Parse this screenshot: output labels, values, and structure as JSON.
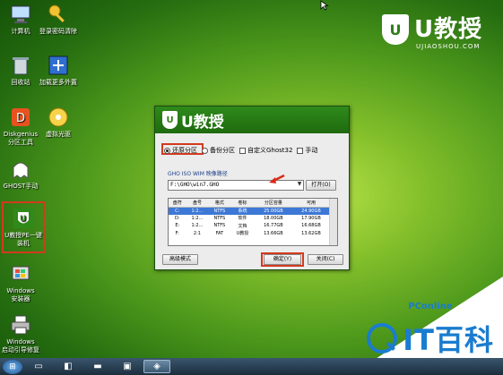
{
  "desktop_icons": [
    {
      "label": "计算机",
      "icon": "computer-icon",
      "name": "desktop-icon-computer"
    },
    {
      "label": "登录密码清除",
      "icon": "key-icon",
      "name": "desktop-icon-password-clear"
    },
    {
      "label": "回收站",
      "icon": "recycle-bin-icon",
      "name": "desktop-icon-recycle-bin"
    },
    {
      "label": "加载更多外置",
      "icon": "puzzle-icon",
      "name": "desktop-icon-load-more"
    },
    {
      "label": "Diskgenius\n分区工具",
      "icon": "diskgenius-icon",
      "name": "desktop-icon-diskgenius"
    },
    {
      "label": "虚拟光驱",
      "icon": "cd-drive-icon",
      "name": "desktop-icon-virtual-drive"
    },
    {
      "label": "GHOST手动",
      "icon": "ghost-icon",
      "name": "desktop-icon-ghost"
    },
    {
      "label": "U教授PE一键\n装机",
      "icon": "ujiaoshou-icon",
      "name": "desktop-icon-pe-install"
    },
    {
      "label": "Windows\n安装器",
      "icon": "windows-installer-icon",
      "name": "desktop-icon-windows-installer"
    },
    {
      "label": "Windows\n启动引导修复",
      "icon": "printer-icon",
      "name": "desktop-icon-boot-repair"
    }
  ],
  "brand": {
    "title": "U教授",
    "subtitle": "UJIAOSHOU.COM",
    "mark": "U"
  },
  "watermark": {
    "line1": "PConline",
    "line2": "IT百科"
  },
  "dialog": {
    "title": "U教授",
    "mark": "U",
    "options": {
      "restore": "还原分区",
      "backup": "备份分区",
      "custom_ghost": "自定义Ghost32",
      "manual": "手动"
    },
    "path_label": "GHO ISO WIM 映像路径",
    "path_value": "F:\\GHO\\win7.GHO",
    "open_button": "打开(O)",
    "table": {
      "headers": [
        "盘符",
        "盘号",
        "格式",
        "卷标",
        "分区容量",
        "可用"
      ],
      "rows": [
        [
          "C:",
          "1:2...",
          "NTFS",
          "系统",
          "25.00GB",
          "24.90GB"
        ],
        [
          "D:",
          "1:2...",
          "NTFS",
          "软件",
          "18.00GB",
          "17.90GB"
        ],
        [
          "E:",
          "1:2...",
          "NTFS",
          "文档",
          "16.77GB",
          "16.68GB"
        ],
        [
          "F:",
          "2:1",
          "FAT",
          "U教授",
          "13.66GB",
          "13.62GB"
        ]
      ]
    },
    "advanced_button": "高级模式",
    "ok_button": "确定(Y)",
    "close_button": "关闭(C)"
  },
  "colors": {
    "desktop_green": "#4f9a1c",
    "highlight_red": "#d23a1e",
    "selection_blue": "#3d78d6"
  }
}
